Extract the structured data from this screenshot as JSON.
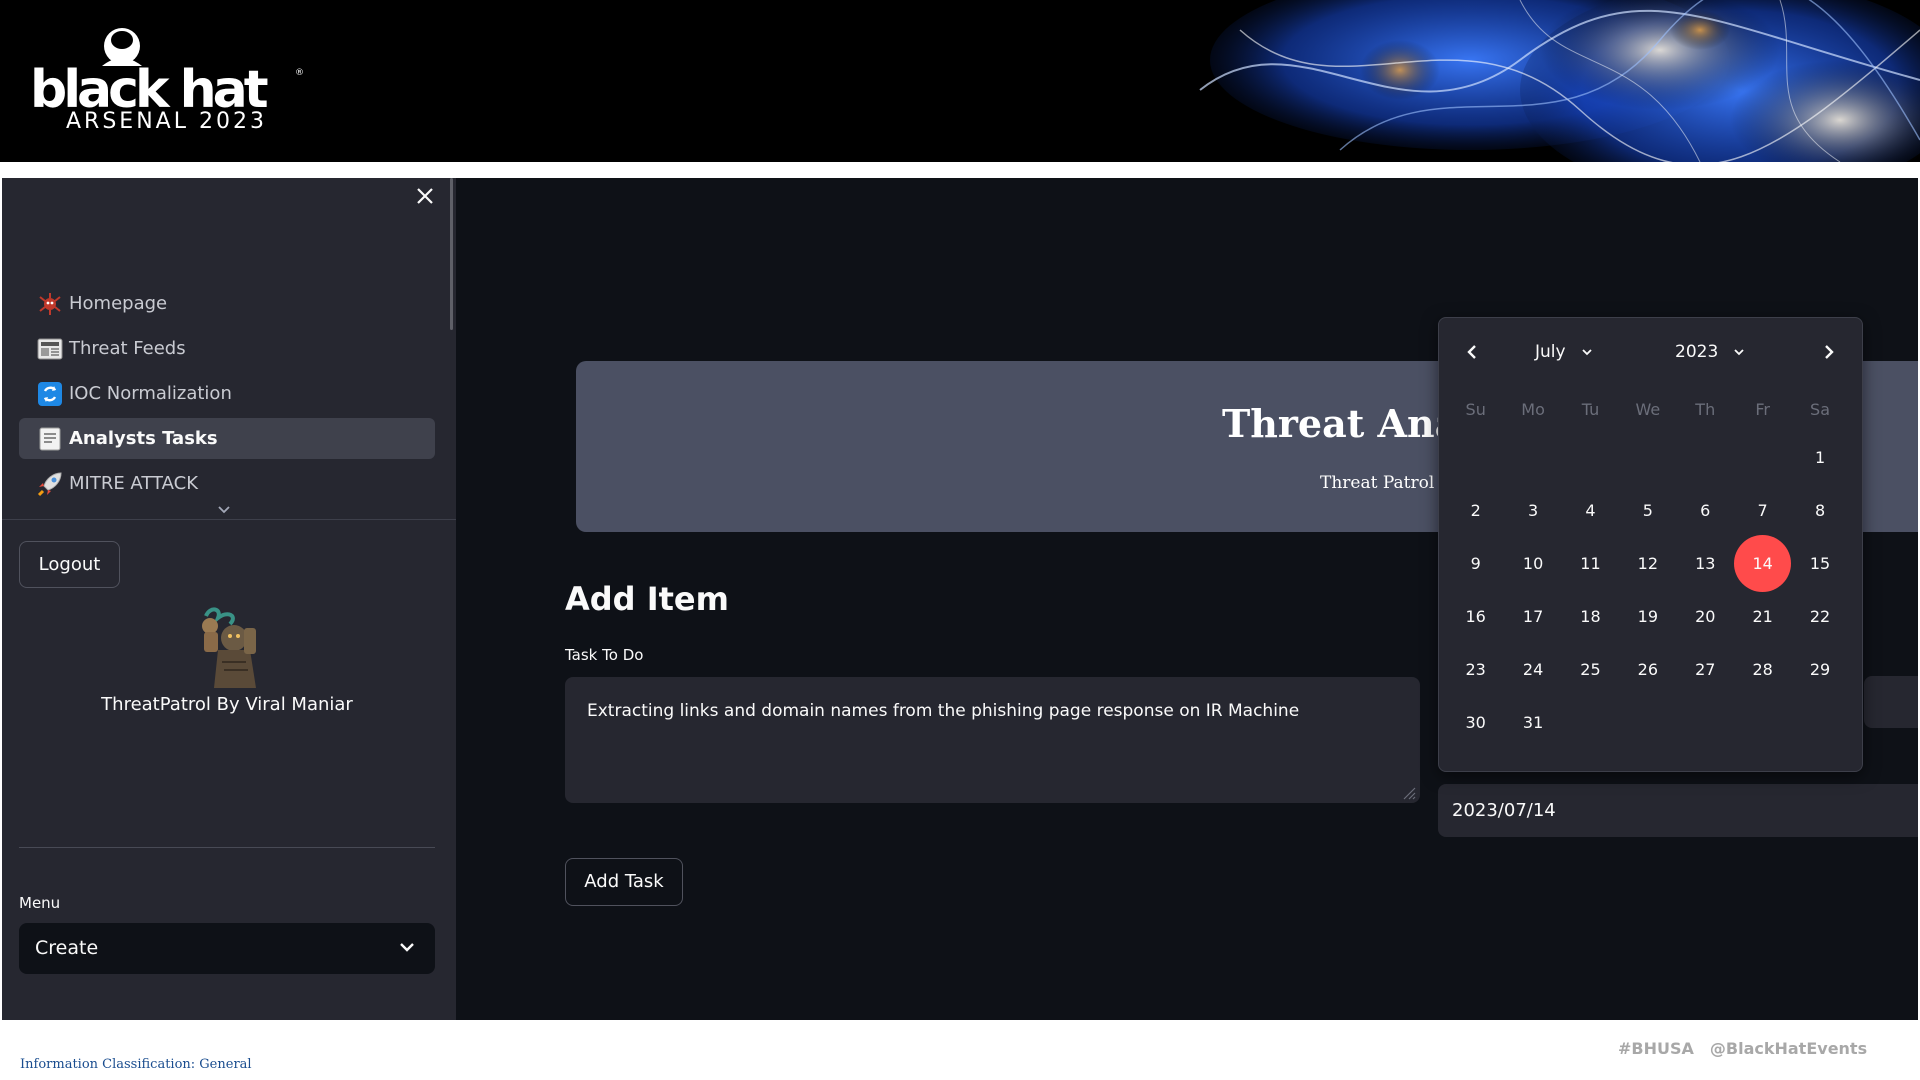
{
  "banner": {
    "logo_main": "black hat",
    "logo_sub": "ARSENAL 2023",
    "logo_reg": "®"
  },
  "sidebar": {
    "close_icon": "close-icon",
    "items": [
      {
        "label": "Homepage",
        "icon": "virus-icon",
        "active": false
      },
      {
        "label": "Threat Feeds",
        "icon": "newspaper-icon",
        "active": false
      },
      {
        "label": "IOC Normalization",
        "icon": "arrows-cycle-icon",
        "active": false
      },
      {
        "label": "Analysts Tasks",
        "icon": "memo-icon",
        "active": true
      },
      {
        "label": "MITRE ATTACK",
        "icon": "rocket-icon",
        "active": false
      }
    ],
    "logout_label": "Logout",
    "avatar_caption": "ThreatPatrol By Viral Maniar",
    "menu_label": "Menu",
    "menu_value": "Create"
  },
  "main": {
    "hero_title": "Threat Ana",
    "hero_subtitle": "Threat Patrol",
    "add_item_heading": "Add Item",
    "task_label": "Task To Do",
    "task_value": "Extracting links and domain names from the phishing page response on IR Machine",
    "add_task_label": "Add Task",
    "date_value": "2023/07/14"
  },
  "calendar": {
    "month": "July",
    "year": "2023",
    "weekdays": [
      "Su",
      "Mo",
      "Tu",
      "We",
      "Th",
      "Fr",
      "Sa"
    ],
    "weeks": [
      [
        "",
        "",
        "",
        "",
        "",
        "",
        "1"
      ],
      [
        "2",
        "3",
        "4",
        "5",
        "6",
        "7",
        "8"
      ],
      [
        "9",
        "10",
        "11",
        "12",
        "13",
        "14",
        "15"
      ],
      [
        "16",
        "17",
        "18",
        "19",
        "20",
        "21",
        "22"
      ],
      [
        "23",
        "24",
        "25",
        "26",
        "27",
        "28",
        "29"
      ],
      [
        "30",
        "31",
        "",
        "",
        "",
        "",
        ""
      ]
    ],
    "selected_day": "14",
    "accent_color": "#ff4b4b"
  },
  "footer": {
    "classification": "Information Classification: General",
    "hashtag": "#BHUSA",
    "handle": "@BlackHatEvents"
  },
  "colors": {
    "app_bg": "#0e1117",
    "sidebar_bg": "#262730",
    "hero_bg": "#4b5063",
    "accent": "#ff4b4b"
  }
}
